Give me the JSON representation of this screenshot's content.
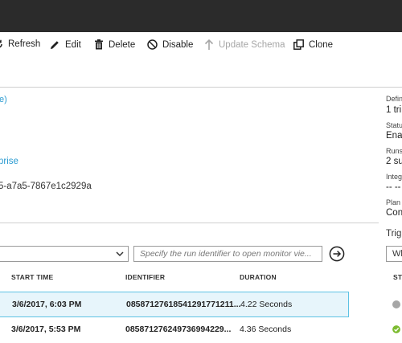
{
  "toolbar": {
    "refresh": "Refresh",
    "edit": "Edit",
    "delete": "Delete",
    "disable": "Disable",
    "update_schema": "Update Schema",
    "clone": "Clone"
  },
  "details": {
    "link1": "e)",
    "link2": "prise",
    "identifier": "5-a7a5-7867e1c2929a"
  },
  "summary": {
    "definition_label": "Defin",
    "definition_value": "1 tri",
    "status_label": "Statu",
    "status_value": "Enab",
    "runs_label": "Runs",
    "runs_value": "2 su",
    "integ_label": "Integ",
    "integ_value": "-- --",
    "plan_label": "Plan",
    "plan_value": "Con"
  },
  "runs": {
    "run_input_placeholder": "Specify the run identifier to open monitor vie...",
    "headers": {
      "start_time": "START TIME",
      "identifier": "IDENTIFIER",
      "duration": "DURATION"
    },
    "rows": [
      {
        "start_time": "3/6/2017, 6:03 PM",
        "identifier": "085871276185412917712​11...",
        "duration": "4.22 Seconds",
        "selected": true,
        "status": "running"
      },
      {
        "start_time": "3/6/2017, 5:53 PM",
        "identifier": "085871276249736994229...",
        "duration": "4.36 Seconds",
        "selected": false,
        "status": "succeeded"
      }
    ]
  },
  "triggers": {
    "header": "Trig",
    "dropdown_value": "Wh",
    "status_header": "STA"
  },
  "colors": {
    "accent": "#2a9bd1",
    "selected_row_bg": "#e7f5fb",
    "selected_row_border": "#5ec2e4",
    "success": "#7cbb2f",
    "running": "#a6a6a6"
  }
}
